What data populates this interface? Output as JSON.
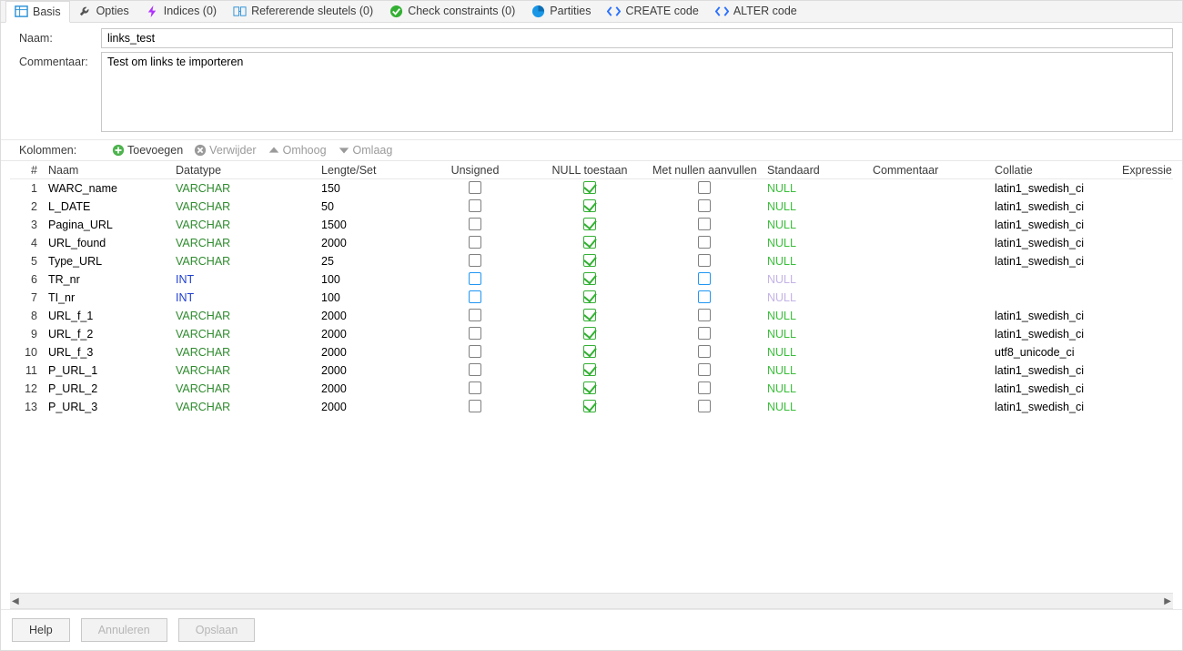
{
  "tabs": [
    {
      "id": "basis",
      "label": "Basis",
      "active": true,
      "icon": "table",
      "color": "#2a90d6"
    },
    {
      "id": "opties",
      "label": "Opties",
      "icon": "wrench",
      "color": "#555"
    },
    {
      "id": "indices",
      "label": "Indices (0)",
      "icon": "bolt",
      "color": "#b030ff"
    },
    {
      "id": "fk",
      "label": "Refererende sleutels (0)",
      "icon": "fkey",
      "color": "#2a90d6"
    },
    {
      "id": "check",
      "label": "Check constraints (0)",
      "icon": "check",
      "color": "#33b033"
    },
    {
      "id": "part",
      "label": "Partities",
      "icon": "pie",
      "color": "#1996e6"
    },
    {
      "id": "create",
      "label": "CREATE code",
      "icon": "code",
      "color": "#2a70ff"
    },
    {
      "id": "alter",
      "label": "ALTER code",
      "icon": "code",
      "color": "#2a70ff"
    }
  ],
  "form": {
    "name_label": "Naam:",
    "name_value": "links_test",
    "comment_label": "Commentaar:",
    "comment_value": "Test om links te importeren"
  },
  "cols_toolbar": {
    "label": "Kolommen:",
    "add": "Toevoegen",
    "remove": "Verwijder",
    "up": "Omhoog",
    "down": "Omlaag"
  },
  "grid_headers": {
    "idx": "#",
    "name": "Naam",
    "dt": "Datatype",
    "len": "Lengte/Set",
    "un": "Unsigned",
    "null": "NULL toestaan",
    "zf": "Met nullen aanvullen",
    "def": "Standaard",
    "comm": "Commentaar",
    "coll": "Collatie",
    "expr": "Expressie"
  },
  "columns": [
    {
      "i": 1,
      "name": "WARC_name",
      "dt": "VARCHAR",
      "len": "150",
      "un": false,
      "null": true,
      "zf": false,
      "def": "NULL",
      "coll": "latin1_swedish_ci",
      "int": false
    },
    {
      "i": 2,
      "name": "L_DATE",
      "dt": "VARCHAR",
      "len": "50",
      "un": false,
      "null": true,
      "zf": false,
      "def": "NULL",
      "coll": "latin1_swedish_ci",
      "int": false
    },
    {
      "i": 3,
      "name": "Pagina_URL",
      "dt": "VARCHAR",
      "len": "1500",
      "un": false,
      "null": true,
      "zf": false,
      "def": "NULL",
      "coll": "latin1_swedish_ci",
      "int": false
    },
    {
      "i": 4,
      "name": "URL_found",
      "dt": "VARCHAR",
      "len": "2000",
      "un": false,
      "null": true,
      "zf": false,
      "def": "NULL",
      "coll": "latin1_swedish_ci",
      "int": false
    },
    {
      "i": 5,
      "name": "Type_URL",
      "dt": "VARCHAR",
      "len": "25",
      "un": false,
      "null": true,
      "zf": false,
      "def": "NULL",
      "coll": "latin1_swedish_ci",
      "int": false
    },
    {
      "i": 6,
      "name": "TR_nr",
      "dt": "INT",
      "len": "100",
      "un": false,
      "null": true,
      "zf": false,
      "def": "NULL",
      "coll": "",
      "int": true,
      "def_disabled": true
    },
    {
      "i": 7,
      "name": "TI_nr",
      "dt": "INT",
      "len": "100",
      "un": false,
      "null": true,
      "zf": false,
      "def": "NULL",
      "coll": "",
      "int": true,
      "def_disabled": true
    },
    {
      "i": 8,
      "name": "URL_f_1",
      "dt": "VARCHAR",
      "len": "2000",
      "un": false,
      "null": true,
      "zf": false,
      "def": "NULL",
      "coll": "latin1_swedish_ci",
      "int": false
    },
    {
      "i": 9,
      "name": "URL_f_2",
      "dt": "VARCHAR",
      "len": "2000",
      "un": false,
      "null": true,
      "zf": false,
      "def": "NULL",
      "coll": "latin1_swedish_ci",
      "int": false
    },
    {
      "i": 10,
      "name": "URL_f_3",
      "dt": "VARCHAR",
      "len": "2000",
      "un": false,
      "null": true,
      "zf": false,
      "def": "NULL",
      "coll": "utf8_unicode_ci",
      "int": false
    },
    {
      "i": 11,
      "name": "P_URL_1",
      "dt": "VARCHAR",
      "len": "2000",
      "un": false,
      "null": true,
      "zf": false,
      "def": "NULL",
      "coll": "latin1_swedish_ci",
      "int": false
    },
    {
      "i": 12,
      "name": "P_URL_2",
      "dt": "VARCHAR",
      "len": "2000",
      "un": false,
      "null": true,
      "zf": false,
      "def": "NULL",
      "coll": "latin1_swedish_ci",
      "int": false
    },
    {
      "i": 13,
      "name": "P_URL_3",
      "dt": "VARCHAR",
      "len": "2000",
      "un": false,
      "null": true,
      "zf": false,
      "def": "NULL",
      "coll": "latin1_swedish_ci",
      "int": false
    }
  ],
  "footer": {
    "help": "Help",
    "cancel": "Annuleren",
    "save": "Opslaan"
  }
}
